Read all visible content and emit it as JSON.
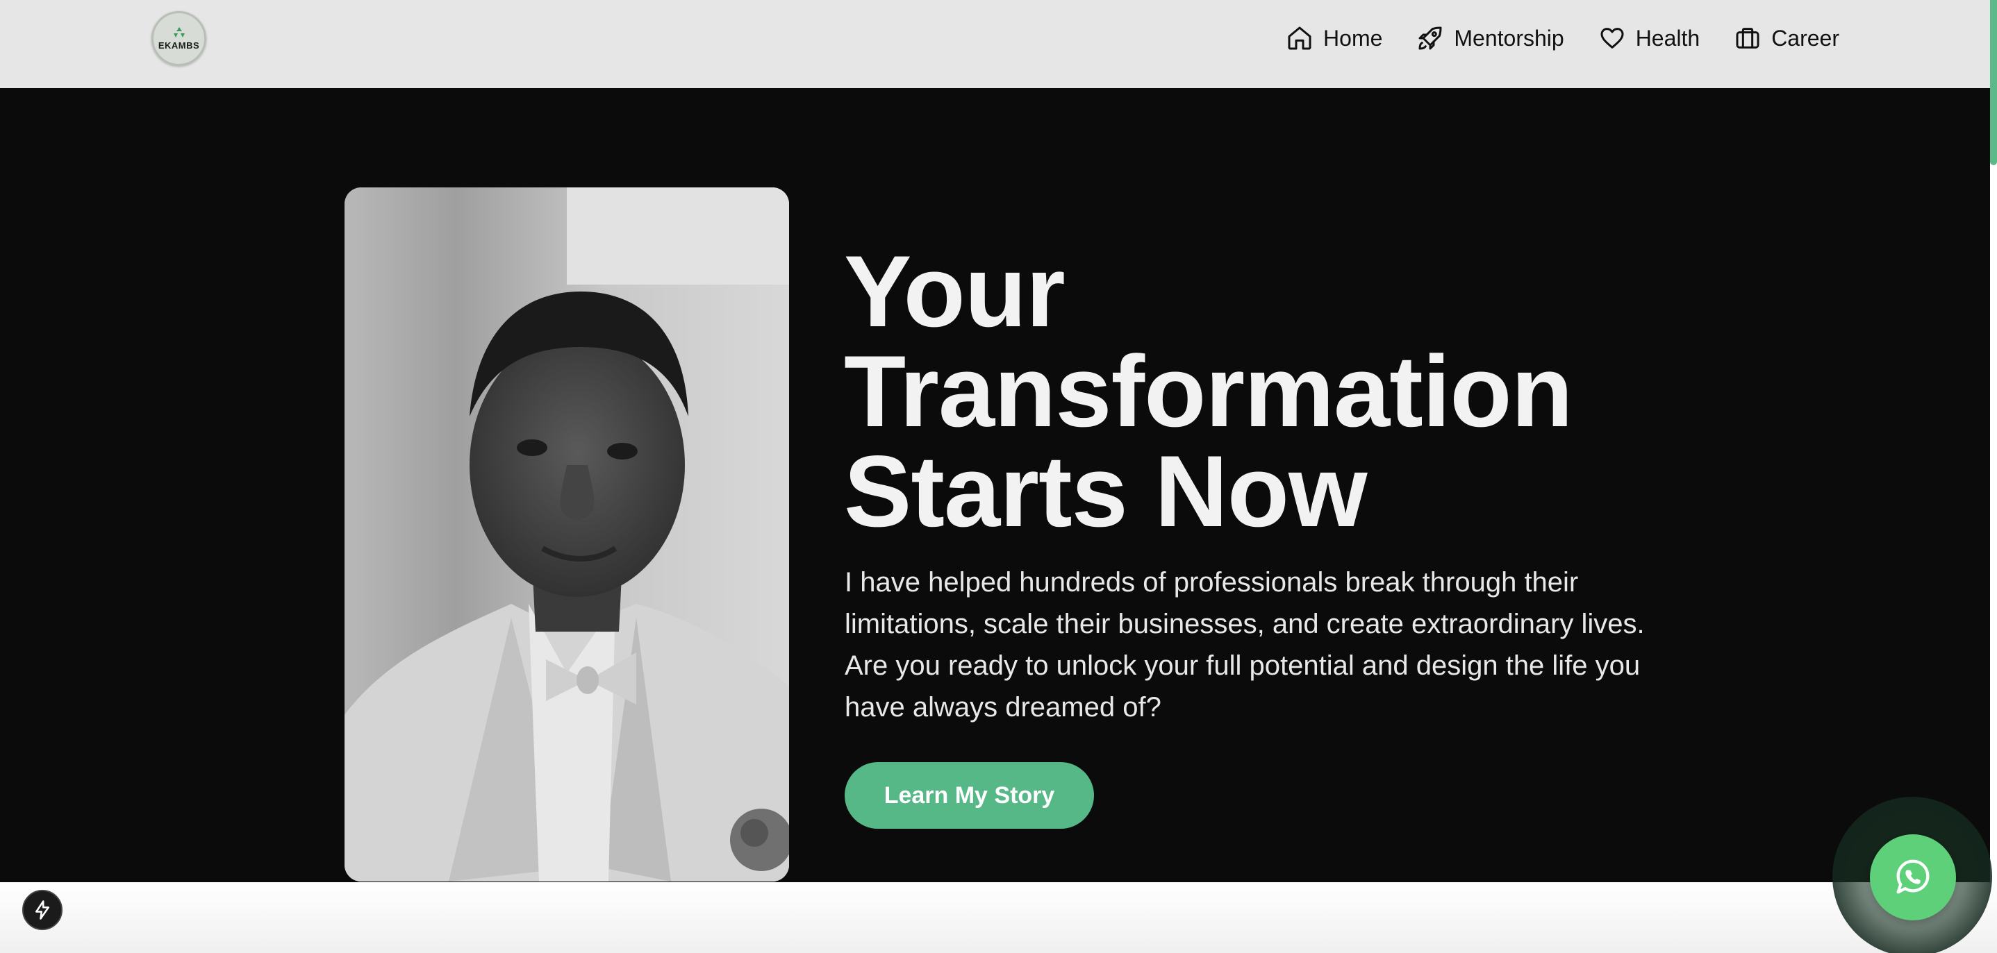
{
  "brand": {
    "logo_text": "EKAMBS"
  },
  "nav": {
    "items": [
      {
        "label": "Home",
        "icon": "home-icon"
      },
      {
        "label": "Mentorship",
        "icon": "rocket-icon"
      },
      {
        "label": "Health",
        "icon": "heart-icon"
      },
      {
        "label": "Career",
        "icon": "briefcase-icon"
      }
    ]
  },
  "hero": {
    "headline": [
      "Your",
      "Transformation",
      "Starts Now"
    ],
    "paragraph": "I have helped hundreds of professionals break through their limitations, scale their businesses, and create extraordinary lives. Are you ready to unlock your full potential and design the life you have always dreamed of?",
    "cta_label": "Learn My Story",
    "portrait_alt": "portrait-photo"
  },
  "floating": {
    "whatsapp_icon": "whatsapp-icon",
    "bolt_icon": "lightning-bolt-icon"
  },
  "colors": {
    "nav_bg": "#e6e6e6",
    "hero_bg": "#0b0b0b",
    "accent": "#56b886",
    "whatsapp": "#5fd07a",
    "heading": "#f2f2f2"
  }
}
